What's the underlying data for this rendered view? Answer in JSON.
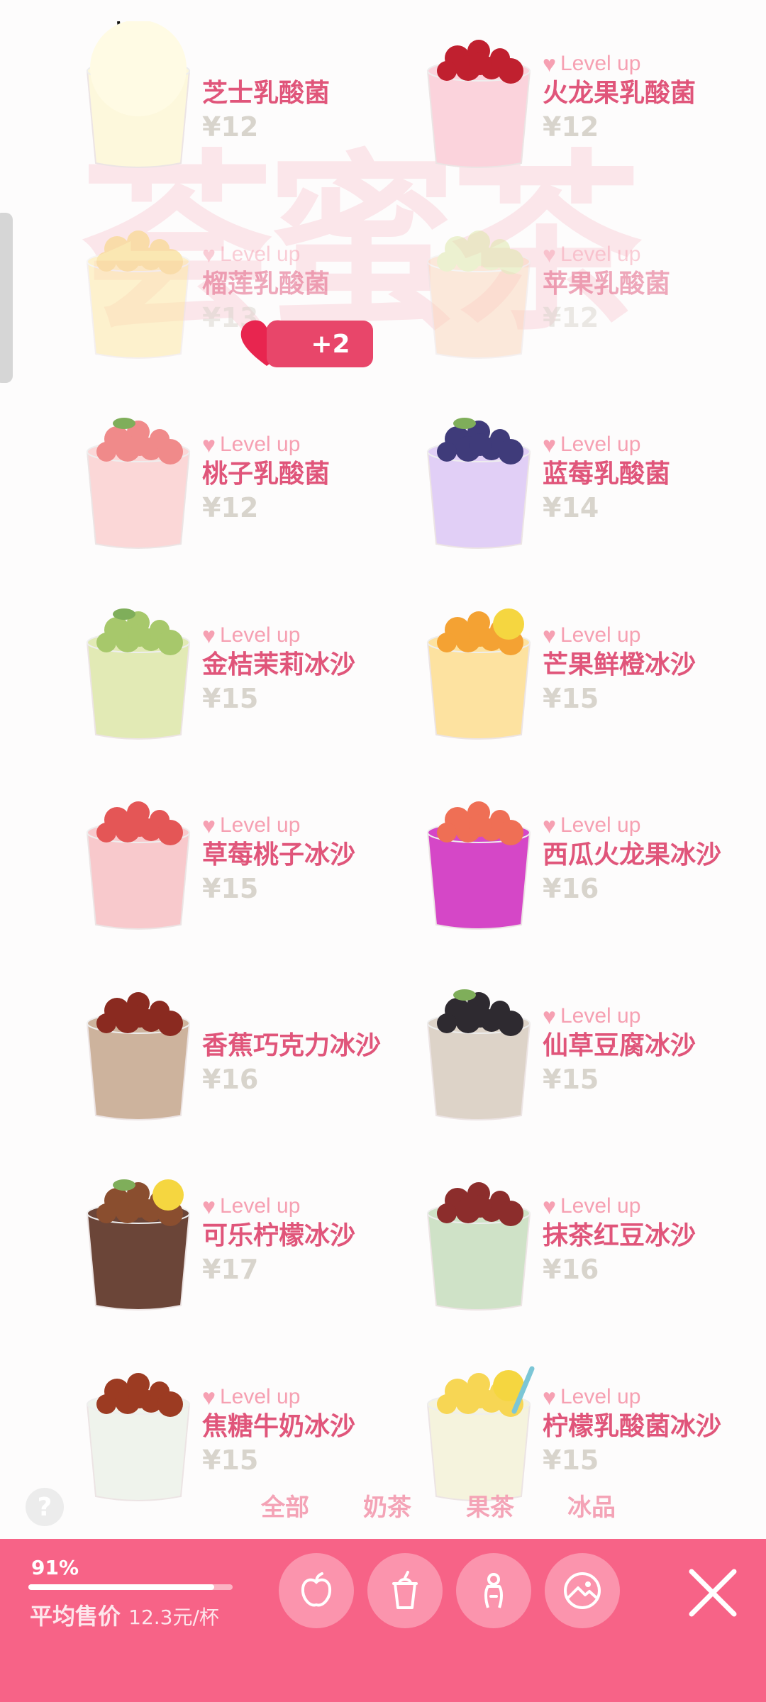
{
  "watermark": "荟蜜茶",
  "level_text": "Level up",
  "items": [
    {
      "name": "芝士乳酸菌",
      "price": "¥12",
      "level_up": false,
      "faded": false,
      "cup": "#fdf8dc",
      "top": "#fffdf0",
      "topping": "straw"
    },
    {
      "name": "火龙果乳酸菌",
      "price": "¥12",
      "level_up": true,
      "faded": false,
      "cup": "#fbd3dc",
      "top": "#c0202f",
      "topping": "dragon"
    },
    {
      "name": "榴莲乳酸菌",
      "price": "¥13",
      "level_up": true,
      "faded": true,
      "cup": "#fde8a0",
      "top": "#f8d36a",
      "topping": "balls"
    },
    {
      "name": "苹果乳酸菌",
      "price": "¥12",
      "level_up": true,
      "faded": true,
      "cup": "#fbd6b9",
      "top": "#dde7a5",
      "topping": "apple"
    },
    {
      "name": "桃子乳酸菌",
      "price": "¥12",
      "level_up": true,
      "faded": false,
      "cup": "#fbd7d7",
      "top": "#f08a8a",
      "topping": "peach"
    },
    {
      "name": "蓝莓乳酸菌",
      "price": "¥14",
      "level_up": true,
      "faded": false,
      "cup": "#e1cff6",
      "top": "#3f3b7a",
      "topping": "berry"
    },
    {
      "name": "金桔茉莉冰沙",
      "price": "¥15",
      "level_up": true,
      "faded": false,
      "cup": "#e2eab5",
      "top": "#a7c86b",
      "topping": "lime"
    },
    {
      "name": "芒果鲜橙冰沙",
      "price": "¥15",
      "level_up": true,
      "faded": false,
      "cup": "#fde2a0",
      "top": "#f4a233",
      "topping": "orange"
    },
    {
      "name": "草莓桃子冰沙",
      "price": "¥15",
      "level_up": true,
      "faded": false,
      "cup": "#f8c9cc",
      "top": "#e45656",
      "topping": "straw2"
    },
    {
      "name": "西瓜火龙果冰沙",
      "price": "¥16",
      "level_up": true,
      "faded": false,
      "cup": "#d547c7",
      "top": "#ef6f55",
      "topping": "melon"
    },
    {
      "name": "香蕉巧克力冰沙",
      "price": "¥16",
      "level_up": false,
      "faded": false,
      "cup": "#cdb39d",
      "top": "#8a2a20",
      "topping": "choc"
    },
    {
      "name": "仙草豆腐冰沙",
      "price": "¥15",
      "level_up": true,
      "faded": false,
      "cup": "#ddd3c8",
      "top": "#2e2a30",
      "topping": "jelly"
    },
    {
      "name": "可乐柠檬冰沙",
      "price": "¥17",
      "level_up": true,
      "faded": false,
      "cup": "#6b4538",
      "top": "#8a4e2f",
      "topping": "cola"
    },
    {
      "name": "抹茶红豆冰沙",
      "price": "¥16",
      "level_up": true,
      "faded": false,
      "cup": "#cfe2c7",
      "top": "#8c2d2c",
      "topping": "bean"
    },
    {
      "name": "焦糖牛奶冰沙",
      "price": "¥15",
      "level_up": true,
      "faded": false,
      "cup": "#eff3ec",
      "top": "#9c3b22",
      "topping": "caramel"
    },
    {
      "name": "柠檬乳酸菌冰沙",
      "price": "¥15",
      "level_up": true,
      "faded": false,
      "cup": "#f5f3dd",
      "top": "#f7d654",
      "topping": "lemon"
    }
  ],
  "badge": {
    "text": "+2"
  },
  "help": "?",
  "tabs": [
    {
      "label": "全部"
    },
    {
      "label": "奶茶"
    },
    {
      "label": "果茶"
    },
    {
      "label": "冰品"
    }
  ],
  "stats": {
    "percent_text": "91%",
    "progress": 0.91,
    "avg_label": "平均售价",
    "avg_value": "12.3元/杯"
  },
  "buttons": [
    {
      "icon": "apple-icon"
    },
    {
      "icon": "cup-icon"
    },
    {
      "icon": "person-icon"
    },
    {
      "icon": "photo-icon"
    }
  ],
  "colors": {
    "accent": "#f76387",
    "name_text": "#e0557a",
    "level_text": "#f6a0b2"
  }
}
